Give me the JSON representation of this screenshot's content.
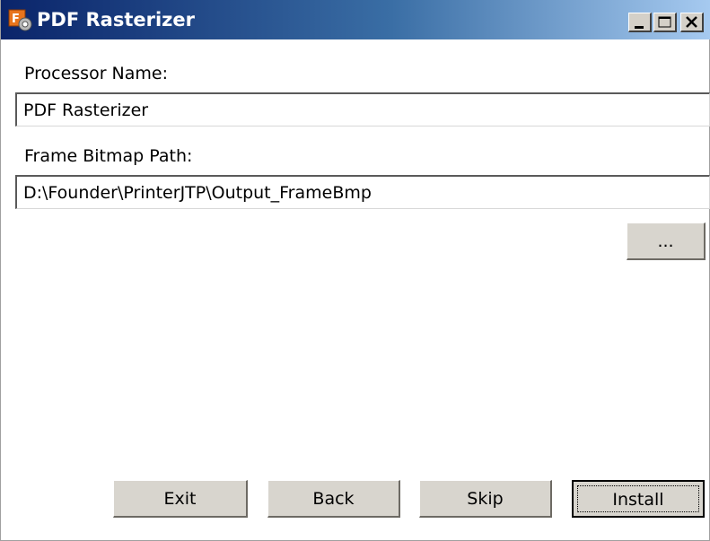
{
  "window": {
    "title": "PDF Rasterizer"
  },
  "fields": {
    "processor_name": {
      "label": "Processor Name:",
      "value": "PDF Rasterizer"
    },
    "frame_bitmap_path": {
      "label": "Frame Bitmap Path:",
      "value": "D:\\Founder\\PrinterJTP\\Output_FrameBmp"
    }
  },
  "buttons": {
    "browse": "...",
    "exit": "Exit",
    "back": "Back",
    "skip": "Skip",
    "install": "Install"
  },
  "icons": {
    "app": "app-installer-icon",
    "minimize": "minimize-icon",
    "maximize": "maximize-icon",
    "close": "close-icon"
  },
  "colors": {
    "titlebar_start": "#0a246a",
    "titlebar_end": "#a6caf0",
    "button_face": "#d8d5ce"
  }
}
